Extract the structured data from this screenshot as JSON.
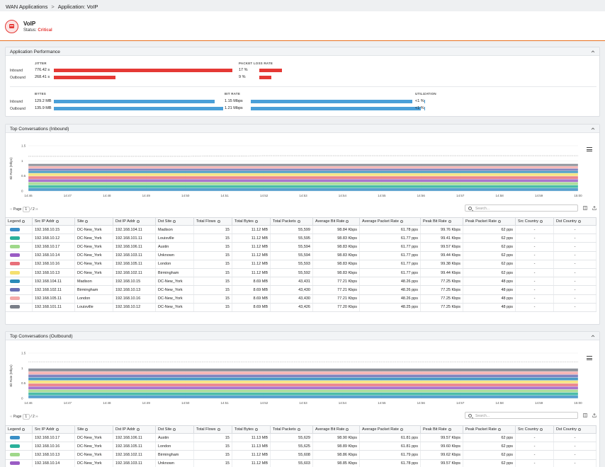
{
  "breadcrumb": {
    "root": "WAN Applications",
    "current": "Application: VoIP"
  },
  "app": {
    "name": "VoIP",
    "status_label": "Status:",
    "status_value": "Critical"
  },
  "perf": {
    "title": "Application Performance",
    "jitter": {
      "label": "JITTER",
      "inbound_label": "Inbound",
      "outbound_label": "Outbound",
      "inbound": "776.42 s",
      "outbound": "268.41 s",
      "inbound_frac": 1.0,
      "outbound_frac": 0.345
    },
    "packet_loss": {
      "label": "PACKET LOSS RATE",
      "inbound": "17 %",
      "outbound": "9 %",
      "inbound_frac": 0.17,
      "outbound_frac": 0.09
    },
    "bytes": {
      "label": "BYTES",
      "inbound_label": "Inbound",
      "outbound_label": "Outbound",
      "inbound": "129.2 MB",
      "outbound": "135.9 MB",
      "inbound_frac": 0.95,
      "outbound_frac": 1.0
    },
    "bitrate": {
      "label": "BIT RATE",
      "inbound": "1.15 Mbps",
      "outbound": "1.21 Mbps",
      "inbound_frac": 0.95,
      "outbound_frac": 1.0
    },
    "utilization": {
      "label": "UTILIZATION",
      "inbound": "<1 %",
      "outbound": "<1 %"
    }
  },
  "chart_common": {
    "ylabel": "Bit Rate (Mbps)",
    "yticks": [
      "1.5",
      "1",
      "0.5",
      "0"
    ],
    "xticks": [
      "14:46",
      "14:47",
      "14:48",
      "14:49",
      "14:50",
      "14:51",
      "14:52",
      "14:53",
      "14:54",
      "14:55",
      "14:56",
      "14:57",
      "14:58",
      "14:59",
      "15:00"
    ]
  },
  "chart_data": [
    {
      "type": "area",
      "title": "Top Conversations (Inbound)",
      "ylabel": "Bit Rate (Mbps)",
      "ylim": [
        0,
        1.5
      ],
      "x": [
        "14:46",
        "14:47",
        "14:48",
        "14:49",
        "14:50",
        "14:51",
        "14:52",
        "14:53",
        "14:54",
        "14:55",
        "14:56",
        "14:57",
        "14:58",
        "14:59",
        "15:00"
      ],
      "stacked": true,
      "total_line": [
        1.15,
        1.15,
        1.15,
        1.15,
        1.15,
        1.16,
        1.17,
        1.17,
        1.17,
        1.17,
        1.17,
        1.17,
        1.17,
        1.17,
        1.17
      ],
      "series": [
        {
          "color": "#3a8fc6",
          "values": [
            0.099,
            0.099,
            0.099,
            0.099,
            0.099,
            0.099,
            0.099,
            0.099,
            0.099,
            0.099,
            0.099,
            0.099,
            0.099,
            0.099,
            0.099
          ]
        },
        {
          "color": "#2ab09a",
          "values": [
            0.099,
            0.099,
            0.099,
            0.099,
            0.099,
            0.099,
            0.099,
            0.099,
            0.099,
            0.099,
            0.099,
            0.099,
            0.099,
            0.099,
            0.099
          ]
        },
        {
          "color": "#9fd88a",
          "values": [
            0.099,
            0.099,
            0.099,
            0.099,
            0.099,
            0.099,
            0.099,
            0.099,
            0.099,
            0.099,
            0.099,
            0.099,
            0.099,
            0.099,
            0.099
          ]
        },
        {
          "color": "#9a5cc4",
          "values": [
            0.099,
            0.099,
            0.099,
            0.099,
            0.099,
            0.099,
            0.099,
            0.099,
            0.099,
            0.099,
            0.099,
            0.099,
            0.099,
            0.099,
            0.099
          ]
        },
        {
          "color": "#e8707a",
          "values": [
            0.099,
            0.099,
            0.099,
            0.099,
            0.099,
            0.099,
            0.099,
            0.099,
            0.099,
            0.099,
            0.099,
            0.099,
            0.099,
            0.099,
            0.099
          ]
        },
        {
          "color": "#f5e070",
          "values": [
            0.099,
            0.099,
            0.099,
            0.099,
            0.099,
            0.099,
            0.099,
            0.099,
            0.099,
            0.099,
            0.099,
            0.099,
            0.099,
            0.099,
            0.099
          ]
        },
        {
          "color": "#2a8ab8",
          "values": [
            0.077,
            0.077,
            0.077,
            0.077,
            0.077,
            0.077,
            0.077,
            0.077,
            0.077,
            0.077,
            0.077,
            0.077,
            0.077,
            0.077,
            0.077
          ]
        },
        {
          "color": "#6a6fb4",
          "values": [
            0.077,
            0.077,
            0.077,
            0.077,
            0.077,
            0.077,
            0.077,
            0.077,
            0.077,
            0.077,
            0.077,
            0.077,
            0.077,
            0.077,
            0.077
          ]
        },
        {
          "color": "#f4a8a8",
          "values": [
            0.077,
            0.077,
            0.077,
            0.077,
            0.077,
            0.077,
            0.077,
            0.077,
            0.077,
            0.077,
            0.077,
            0.077,
            0.077,
            0.077,
            0.077
          ]
        },
        {
          "color": "#7a7f88",
          "values": [
            0.077,
            0.077,
            0.077,
            0.077,
            0.077,
            0.077,
            0.077,
            0.077,
            0.077,
            0.077,
            0.077,
            0.077,
            0.077,
            0.077,
            0.077
          ]
        }
      ]
    },
    {
      "type": "area",
      "title": "Top Conversations (Outbound)",
      "ylabel": "Bit Rate (Mbps)",
      "ylim": [
        0,
        1.5
      ],
      "x": [
        "14:46",
        "14:47",
        "14:48",
        "14:49",
        "14:50",
        "14:51",
        "14:52",
        "14:53",
        "14:54",
        "14:55",
        "14:56",
        "14:57",
        "14:58",
        "14:59",
        "15:00"
      ],
      "stacked": true,
      "total_line": [
        1.21,
        1.21,
        1.21,
        1.21,
        1.21,
        1.21,
        1.21,
        1.21,
        1.21,
        1.21,
        1.21,
        1.21,
        1.21,
        1.21,
        1.21
      ],
      "series": [
        {
          "color": "#3a8fc6",
          "values": [
            0.099,
            0.099,
            0.099,
            0.099,
            0.099,
            0.099,
            0.099,
            0.099,
            0.099,
            0.099,
            0.099,
            0.099,
            0.099,
            0.099,
            0.099
          ]
        },
        {
          "color": "#2ab09a",
          "values": [
            0.099,
            0.099,
            0.099,
            0.099,
            0.099,
            0.099,
            0.099,
            0.099,
            0.099,
            0.099,
            0.099,
            0.099,
            0.099,
            0.099,
            0.099
          ]
        },
        {
          "color": "#9fd88a",
          "values": [
            0.099,
            0.099,
            0.099,
            0.099,
            0.099,
            0.099,
            0.099,
            0.099,
            0.099,
            0.099,
            0.099,
            0.099,
            0.099,
            0.099,
            0.099
          ]
        },
        {
          "color": "#9a5cc4",
          "values": [
            0.099,
            0.099,
            0.099,
            0.099,
            0.099,
            0.099,
            0.099,
            0.099,
            0.099,
            0.099,
            0.099,
            0.099,
            0.099,
            0.099,
            0.099
          ]
        },
        {
          "color": "#e8707a",
          "values": [
            0.099,
            0.099,
            0.099,
            0.099,
            0.099,
            0.099,
            0.099,
            0.099,
            0.099,
            0.099,
            0.099,
            0.099,
            0.099,
            0.099,
            0.099
          ]
        },
        {
          "color": "#f5e070",
          "values": [
            0.099,
            0.099,
            0.099,
            0.099,
            0.099,
            0.099,
            0.099,
            0.099,
            0.099,
            0.099,
            0.099,
            0.099,
            0.099,
            0.099,
            0.099
          ]
        },
        {
          "color": "#2a8ab8",
          "values": [
            0.099,
            0.099,
            0.099,
            0.099,
            0.099,
            0.099,
            0.099,
            0.099,
            0.099,
            0.099,
            0.099,
            0.099,
            0.099,
            0.099,
            0.099
          ]
        },
        {
          "color": "#6a6fb4",
          "values": [
            0.099,
            0.099,
            0.099,
            0.099,
            0.099,
            0.099,
            0.099,
            0.099,
            0.099,
            0.099,
            0.099,
            0.099,
            0.099,
            0.099,
            0.099
          ]
        },
        {
          "color": "#f4a8a8",
          "values": [
            0.099,
            0.099,
            0.099,
            0.099,
            0.099,
            0.099,
            0.099,
            0.099,
            0.099,
            0.099,
            0.099,
            0.099,
            0.099,
            0.099,
            0.099
          ]
        },
        {
          "color": "#7a7f88",
          "values": [
            0.099,
            0.099,
            0.099,
            0.099,
            0.099,
            0.099,
            0.099,
            0.099,
            0.099,
            0.099,
            0.099,
            0.099,
            0.099,
            0.099,
            0.099
          ]
        }
      ]
    }
  ],
  "inbound": {
    "title": "Top Conversations (Inbound)",
    "page_label": "Page",
    "page_value": "1",
    "page_total": "/ 2",
    "search_placeholder": "Search...",
    "columns": [
      "Legend",
      "Src IP Addr",
      "Site",
      "Dst IP Addr",
      "Dst Site",
      "Total Flows",
      "Total Bytes",
      "Total Packets",
      "Average Bit Rate",
      "Average Packet Rate",
      "Peak Bit Rate",
      "Peak Packet Rate",
      "Src Country",
      "Dst Country"
    ],
    "rows": [
      {
        "color": "#3a8fc6",
        "cells": [
          "192.168.10.15",
          "DC-New_York",
          "192.168.104.11",
          "Madison",
          "15",
          "11.12 MB",
          "55,599",
          "98.84 Kbps",
          "61.78 pps",
          "99.76 Kbps",
          "62 pps",
          "-",
          "-"
        ]
      },
      {
        "color": "#2ab09a",
        "cells": [
          "192.168.10.12",
          "DC-New_York",
          "192.168.101.11",
          "Louisville",
          "15",
          "11.12 MB",
          "55,595",
          "98.83 Kbps",
          "61.77 pps",
          "99.41 Kbps",
          "62 pps",
          "-",
          "-"
        ]
      },
      {
        "color": "#9fd88a",
        "cells": [
          "192.168.10.17",
          "DC-New_York",
          "192.168.106.11",
          "Austin",
          "15",
          "11.12 MB",
          "55,594",
          "98.83 Kbps",
          "61.77 pps",
          "99.57 Kbps",
          "62 pps",
          "-",
          "-"
        ]
      },
      {
        "color": "#9a5cc4",
        "cells": [
          "192.168.10.14",
          "DC-New_York",
          "192.168.103.11",
          "Unknown",
          "15",
          "11.12 MB",
          "55,594",
          "98.83 Kbps",
          "61.77 pps",
          "99.44 Kbps",
          "62 pps",
          "-",
          "-"
        ]
      },
      {
        "color": "#e8707a",
        "cells": [
          "192.168.10.16",
          "DC-New_York",
          "192.168.105.11",
          "London",
          "15",
          "11.12 MB",
          "55,593",
          "98.83 Kbps",
          "61.77 pps",
          "99.38 Kbps",
          "62 pps",
          "-",
          "-"
        ]
      },
      {
        "color": "#f5e070",
        "cells": [
          "192.168.10.13",
          "DC-New_York",
          "192.168.102.11",
          "Birmingham",
          "15",
          "11.12 MB",
          "55,592",
          "98.83 Kbps",
          "61.77 pps",
          "99.44 Kbps",
          "62 pps",
          "-",
          "-"
        ]
      },
      {
        "color": "#2a8ab8",
        "cells": [
          "192.168.104.11",
          "Madison",
          "192.168.10.15",
          "DC-New_York",
          "15",
          "8.69 MB",
          "43,431",
          "77.21 Kbps",
          "48.26 pps",
          "77.25 Kbps",
          "48 pps",
          "-",
          "-"
        ]
      },
      {
        "color": "#6a6fb4",
        "cells": [
          "192.168.102.11",
          "Birmingham",
          "192.168.10.13",
          "DC-New_York",
          "15",
          "8.69 MB",
          "43,430",
          "77.21 Kbps",
          "48.26 pps",
          "77.25 Kbps",
          "48 pps",
          "-",
          "-"
        ]
      },
      {
        "color": "#f4a8a8",
        "cells": [
          "192.168.105.11",
          "London",
          "192.168.10.16",
          "DC-New_York",
          "15",
          "8.69 MB",
          "43,430",
          "77.21 Kbps",
          "48.26 pps",
          "77.25 Kbps",
          "48 pps",
          "-",
          "-"
        ]
      },
      {
        "color": "#7a7f88",
        "cells": [
          "192.168.101.11",
          "Louisville",
          "192.168.10.12",
          "DC-New_York",
          "15",
          "8.69 MB",
          "43,426",
          "77.20 Kbps",
          "48.25 pps",
          "77.25 Kbps",
          "48 pps",
          "-",
          "-"
        ]
      }
    ]
  },
  "outbound": {
    "title": "Top Conversations (Outbound)",
    "page_label": "Page",
    "page_value": "1",
    "page_total": "/ 2",
    "search_placeholder": "Search...",
    "columns": [
      "Legend",
      "Src IP Addr",
      "Site",
      "Dst IP Addr",
      "Dst Site",
      "Total Flows",
      "Total Bytes",
      "Total Packets",
      "Average Bit Rate",
      "Average Packet Rate",
      "Peak Bit Rate",
      "Peak Packet Rate",
      "Src Country",
      "Dst Country"
    ],
    "rows": [
      {
        "color": "#3a8fc6",
        "cells": [
          "192.168.10.17",
          "DC-New_York",
          "192.168.106.11",
          "Austin",
          "15",
          "11.13 MB",
          "55,629",
          "98.90 Kbps",
          "61.81 pps",
          "99.57 Kbps",
          "62 pps",
          "-",
          "-"
        ]
      },
      {
        "color": "#2ab09a",
        "cells": [
          "192.168.10.16",
          "DC-New_York",
          "192.168.105.11",
          "London",
          "15",
          "11.13 MB",
          "55,625",
          "98.89 Kbps",
          "61.81 pps",
          "99.60 Kbps",
          "62 pps",
          "-",
          "-"
        ]
      },
      {
        "color": "#9fd88a",
        "cells": [
          "192.168.10.13",
          "DC-New_York",
          "192.168.102.11",
          "Birmingham",
          "15",
          "11.12 MB",
          "55,608",
          "98.86 Kbps",
          "61.79 pps",
          "99.62 Kbps",
          "62 pps",
          "-",
          "-"
        ]
      },
      {
        "color": "#9a5cc4",
        "cells": [
          "192.168.10.14",
          "DC-New_York",
          "192.168.103.11",
          "Unknown",
          "15",
          "11.12 MB",
          "55,603",
          "98.85 Kbps",
          "61.78 pps",
          "99.57 Kbps",
          "62 pps",
          "-",
          "-"
        ]
      }
    ]
  }
}
